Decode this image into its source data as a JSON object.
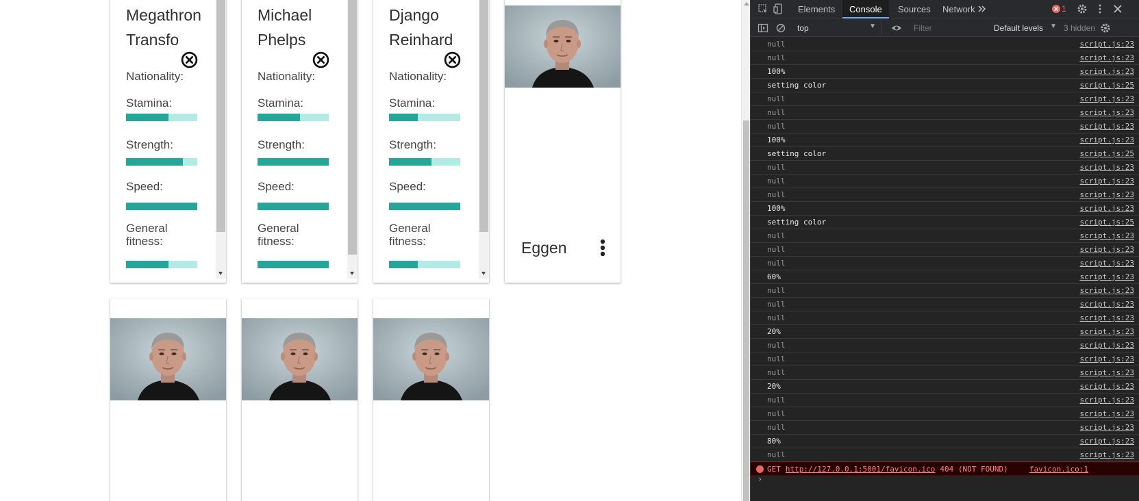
{
  "cards_top": [
    {
      "name": "Megathron Transfo",
      "stats": [
        {
          "label": "Nationality:",
          "value": null
        },
        {
          "label": "Stamina:",
          "value": 0.6
        },
        {
          "label": "Strength:",
          "value": 0.8
        },
        {
          "label": "Speed:",
          "value": 1.0
        },
        {
          "label": "General fitness:",
          "value": 0.6
        }
      ]
    },
    {
      "name": "Michael Phelps",
      "stats": [
        {
          "label": "Nationality:",
          "value": null
        },
        {
          "label": "Stamina:",
          "value": 0.6
        },
        {
          "label": "Strength:",
          "value": 1.0
        },
        {
          "label": "Speed:",
          "value": 1.0
        },
        {
          "label": "General fitness:",
          "value": 1.0
        }
      ]
    },
    {
      "name": "Django Reinhard",
      "stats": [
        {
          "label": "Nationality:",
          "value": null
        },
        {
          "label": "Stamina:",
          "value": 0.4
        },
        {
          "label": "Strength:",
          "value": 0.6
        },
        {
          "label": "Speed:",
          "value": 1.0
        },
        {
          "label": "General fitness:",
          "value": 0.4
        }
      ]
    }
  ],
  "card_eggen": {
    "title": "Eggen"
  },
  "colors": {
    "bar_fill": "#26a69a",
    "bar_track": "#b2ebe6"
  },
  "devtools": {
    "tabs": [
      "Elements",
      "Console",
      "Sources",
      "Network"
    ],
    "active_tab": "Console",
    "error_count": "1",
    "context": "top",
    "filter_placeholder": "Filter",
    "levels": "Default levels",
    "hidden": "3 hidden",
    "logs": [
      {
        "msg": "null",
        "src": "script.js:23"
      },
      {
        "msg": "null",
        "src": "script.js:23"
      },
      {
        "msg": "100%",
        "src": "script.js:23",
        "bright": true
      },
      {
        "msg": "setting color",
        "src": "script.js:25",
        "bright": true
      },
      {
        "msg": "null",
        "src": "script.js:23"
      },
      {
        "msg": "null",
        "src": "script.js:23"
      },
      {
        "msg": "null",
        "src": "script.js:23"
      },
      {
        "msg": "100%",
        "src": "script.js:23",
        "bright": true
      },
      {
        "msg": "setting color",
        "src": "script.js:25",
        "bright": true
      },
      {
        "msg": "null",
        "src": "script.js:23"
      },
      {
        "msg": "null",
        "src": "script.js:23"
      },
      {
        "msg": "null",
        "src": "script.js:23"
      },
      {
        "msg": "100%",
        "src": "script.js:23",
        "bright": true
      },
      {
        "msg": "setting color",
        "src": "script.js:25",
        "bright": true
      },
      {
        "msg": "null",
        "src": "script.js:23"
      },
      {
        "msg": "null",
        "src": "script.js:23"
      },
      {
        "msg": "null",
        "src": "script.js:23"
      },
      {
        "msg": "60%",
        "src": "script.js:23",
        "bright": true
      },
      {
        "msg": "null",
        "src": "script.js:23"
      },
      {
        "msg": "null",
        "src": "script.js:23"
      },
      {
        "msg": "null",
        "src": "script.js:23"
      },
      {
        "msg": "20%",
        "src": "script.js:23",
        "bright": true
      },
      {
        "msg": "null",
        "src": "script.js:23"
      },
      {
        "msg": "null",
        "src": "script.js:23"
      },
      {
        "msg": "null",
        "src": "script.js:23"
      },
      {
        "msg": "20%",
        "src": "script.js:23",
        "bright": true
      },
      {
        "msg": "null",
        "src": "script.js:23"
      },
      {
        "msg": "null",
        "src": "script.js:23"
      },
      {
        "msg": "null",
        "src": "script.js:23"
      },
      {
        "msg": "80%",
        "src": "script.js:23",
        "bright": true
      },
      {
        "msg": "null",
        "src": "script.js:23"
      }
    ],
    "error": {
      "method": "GET",
      "url": "http://127.0.0.1:5001/favicon.ico",
      "status": "404 (NOT FOUND)",
      "src": "favicon.ico:1"
    },
    "prompt": "›"
  }
}
